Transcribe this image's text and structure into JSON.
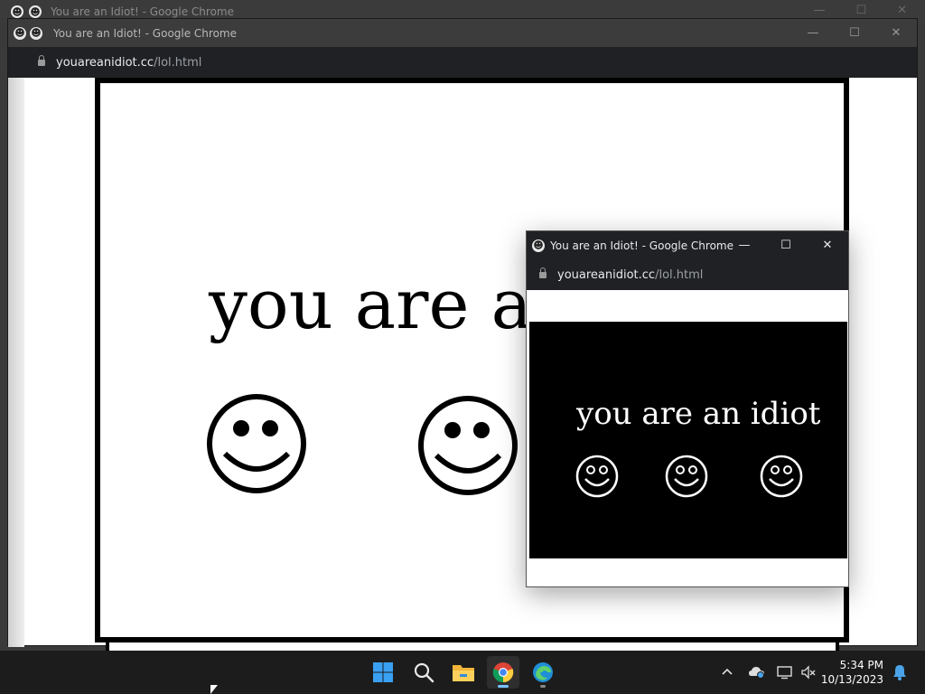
{
  "window": {
    "title": "You are an Idiot! - Google Chrome",
    "url_host": "youareanidiot.cc",
    "url_path": "/lol.html"
  },
  "page": {
    "main_text": "you are an idiot"
  },
  "popup": {
    "title": "You are an Idiot! - Google Chrome",
    "url_host": "youareanidiot.cc",
    "url_path": "/lol.html",
    "main_text": "you are an idiot"
  },
  "taskbar": {
    "apps": [
      "start-icon",
      "search-icon",
      "file-explorer-icon",
      "chrome-icon",
      "edge-icon"
    ],
    "clock_time": "5:34 PM",
    "clock_date": "10/13/2023"
  },
  "colors": {
    "titlebar": "#3c3c3c",
    "addressbar": "#202124",
    "taskbar": "#1c1c1c",
    "windows_blue": "#0078d4"
  }
}
